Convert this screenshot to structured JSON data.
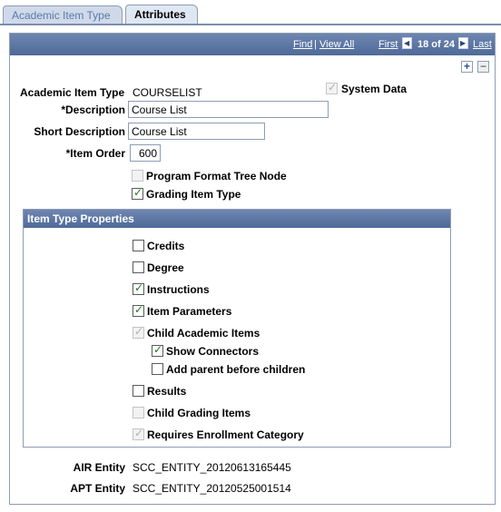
{
  "tabs": [
    {
      "label": "Academic Item Type",
      "active": false
    },
    {
      "label": "Attributes",
      "active": true
    }
  ],
  "navbar": {
    "find": "Find",
    "separator": "|",
    "view_all": "View All",
    "first": "First",
    "counter": "18 of 24",
    "last": "Last"
  },
  "icons": {
    "add": "+",
    "remove": "−"
  },
  "form": {
    "academic_item_type_label": "Academic Item Type",
    "academic_item_type_value": "COURSELIST",
    "system_data_label": "System Data",
    "description_label": "*Description",
    "description_value": "Course List",
    "short_description_label": "Short Description",
    "short_description_value": "Course List",
    "item_order_label": "*Item Order",
    "item_order_value": "600",
    "program_format_label": "Program Format Tree Node",
    "grading_item_label": "Grading Item Type"
  },
  "properties": {
    "header": "Item Type Properties",
    "credits": "Credits",
    "degree": "Degree",
    "instructions": "Instructions",
    "item_parameters": "Item Parameters",
    "child_academic_items": "Child Academic Items",
    "show_connectors": "Show Connectors",
    "add_parent": "Add parent before children",
    "results": "Results",
    "child_grading_items": "Child Grading Items",
    "requires_enrollment": "Requires Enrollment Category"
  },
  "entities": {
    "air_label": "AIR Entity",
    "air_value": "SCC_ENTITY_20120613165445",
    "apt_label": "APT Entity",
    "apt_value": "SCC_ENTITY_20120525001514"
  },
  "colors": {
    "header_bg": "#5b76a6",
    "check_green": "#1a7a1a"
  }
}
